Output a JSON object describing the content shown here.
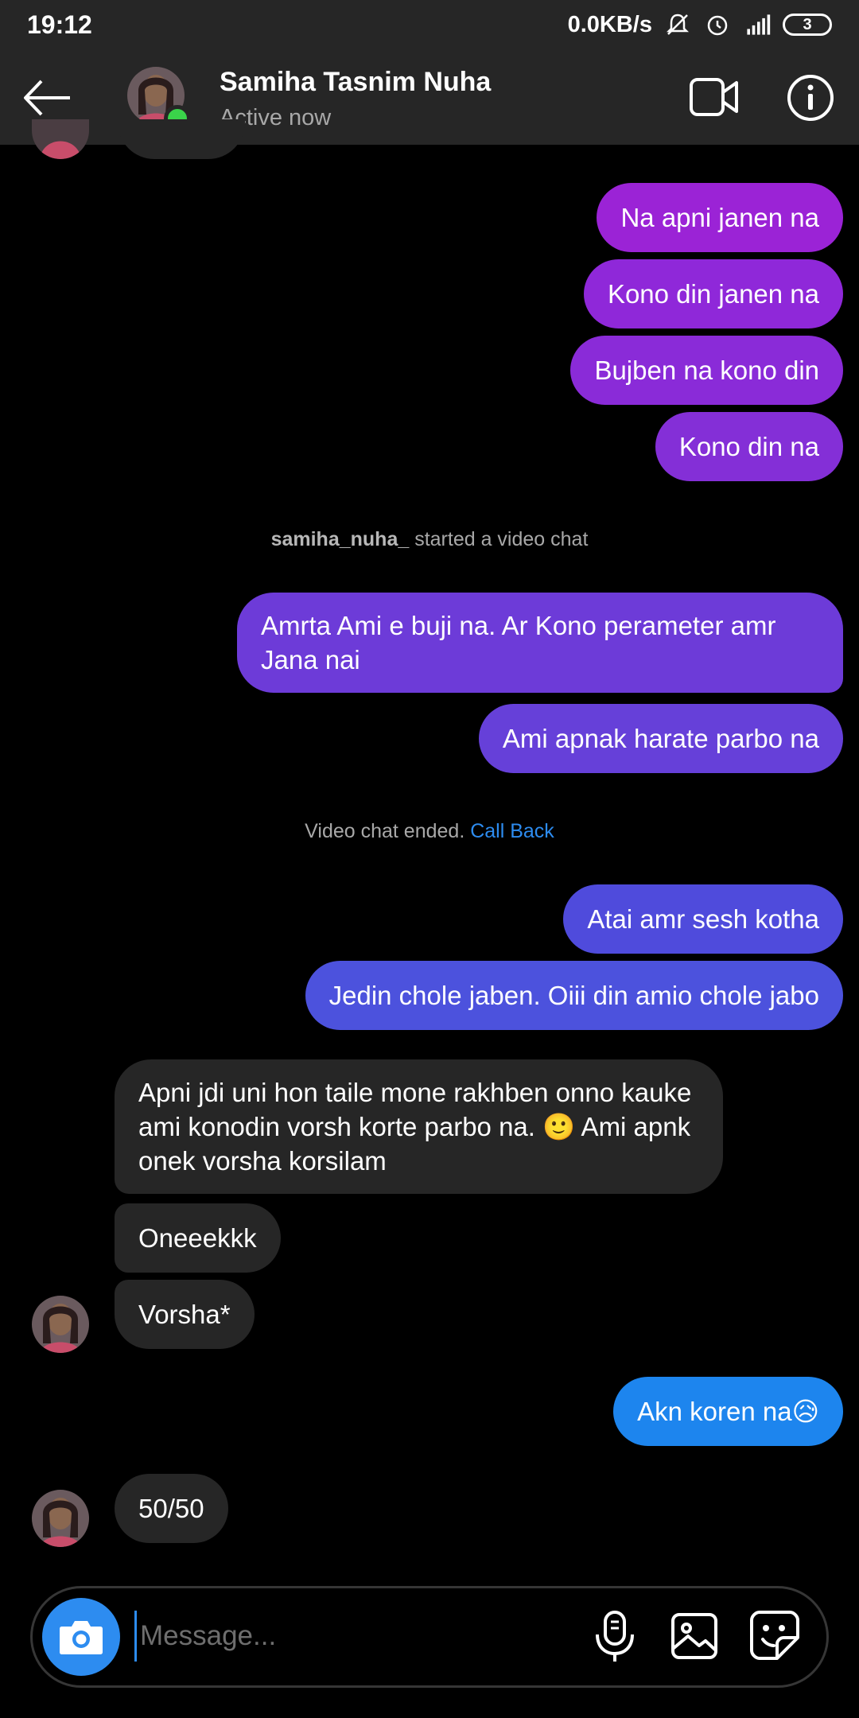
{
  "status_bar": {
    "time": "19:12",
    "net_speed": "0.0KB/s",
    "battery_level": "3",
    "icons": [
      "mute-bell-icon",
      "alarm-icon",
      "signal-icon"
    ]
  },
  "header": {
    "name": "Samiha Tasnim Nuha",
    "status": "Active now",
    "icons": [
      "back-arrow-icon",
      "video-call-icon",
      "info-icon"
    ]
  },
  "messages": [
    {
      "dir": "out",
      "text": "Na apni janen na",
      "color": "#9b23d6"
    },
    {
      "dir": "out",
      "text": "Kono din janen na",
      "color": "#8f28d9"
    },
    {
      "dir": "out",
      "text": "Bujben na kono din",
      "color": "#8a2bd8"
    },
    {
      "dir": "out",
      "text": "Kono din na",
      "color": "#842fd7"
    },
    {
      "dir": "system",
      "user": "samiha_nuha_",
      "text": " started a video chat"
    },
    {
      "dir": "out",
      "text": "Amrta Ami e buji na. Ar Kono perameter amr Jana nai",
      "color": "#6d3bd8"
    },
    {
      "dir": "out",
      "text": "Ami apnak harate parbo na",
      "color": "#6640d9"
    },
    {
      "dir": "system",
      "text": "Video chat ended. ",
      "link": "Call Back"
    },
    {
      "dir": "out",
      "text": "Atai amr sesh kotha",
      "color": "#4f4bdc"
    },
    {
      "dir": "out",
      "text": "Jedin chole jaben. Oiii din amio chole jabo",
      "color": "#4c52dd"
    },
    {
      "dir": "in",
      "text": "Apni jdi uni hon taile mone rakhben onno kauke ami konodin vorsh korte parbo na. 🙂 Ami apnk onek vorsha korsilam"
    },
    {
      "dir": "in",
      "text": "Oneeekkk"
    },
    {
      "dir": "in",
      "text": "Vorsha*"
    },
    {
      "dir": "out",
      "text": "Akn koren na😥",
      "color": "#1d85ee"
    },
    {
      "dir": "in",
      "text": "50/50"
    }
  ],
  "composer": {
    "placeholder": "Message...",
    "icons": [
      "camera-icon",
      "microphone-icon",
      "gallery-icon",
      "sticker-icon"
    ]
  },
  "colors": {
    "accent": "#2d8cf0",
    "incoming_bubble": "#262626",
    "online": "#3ad34a"
  }
}
